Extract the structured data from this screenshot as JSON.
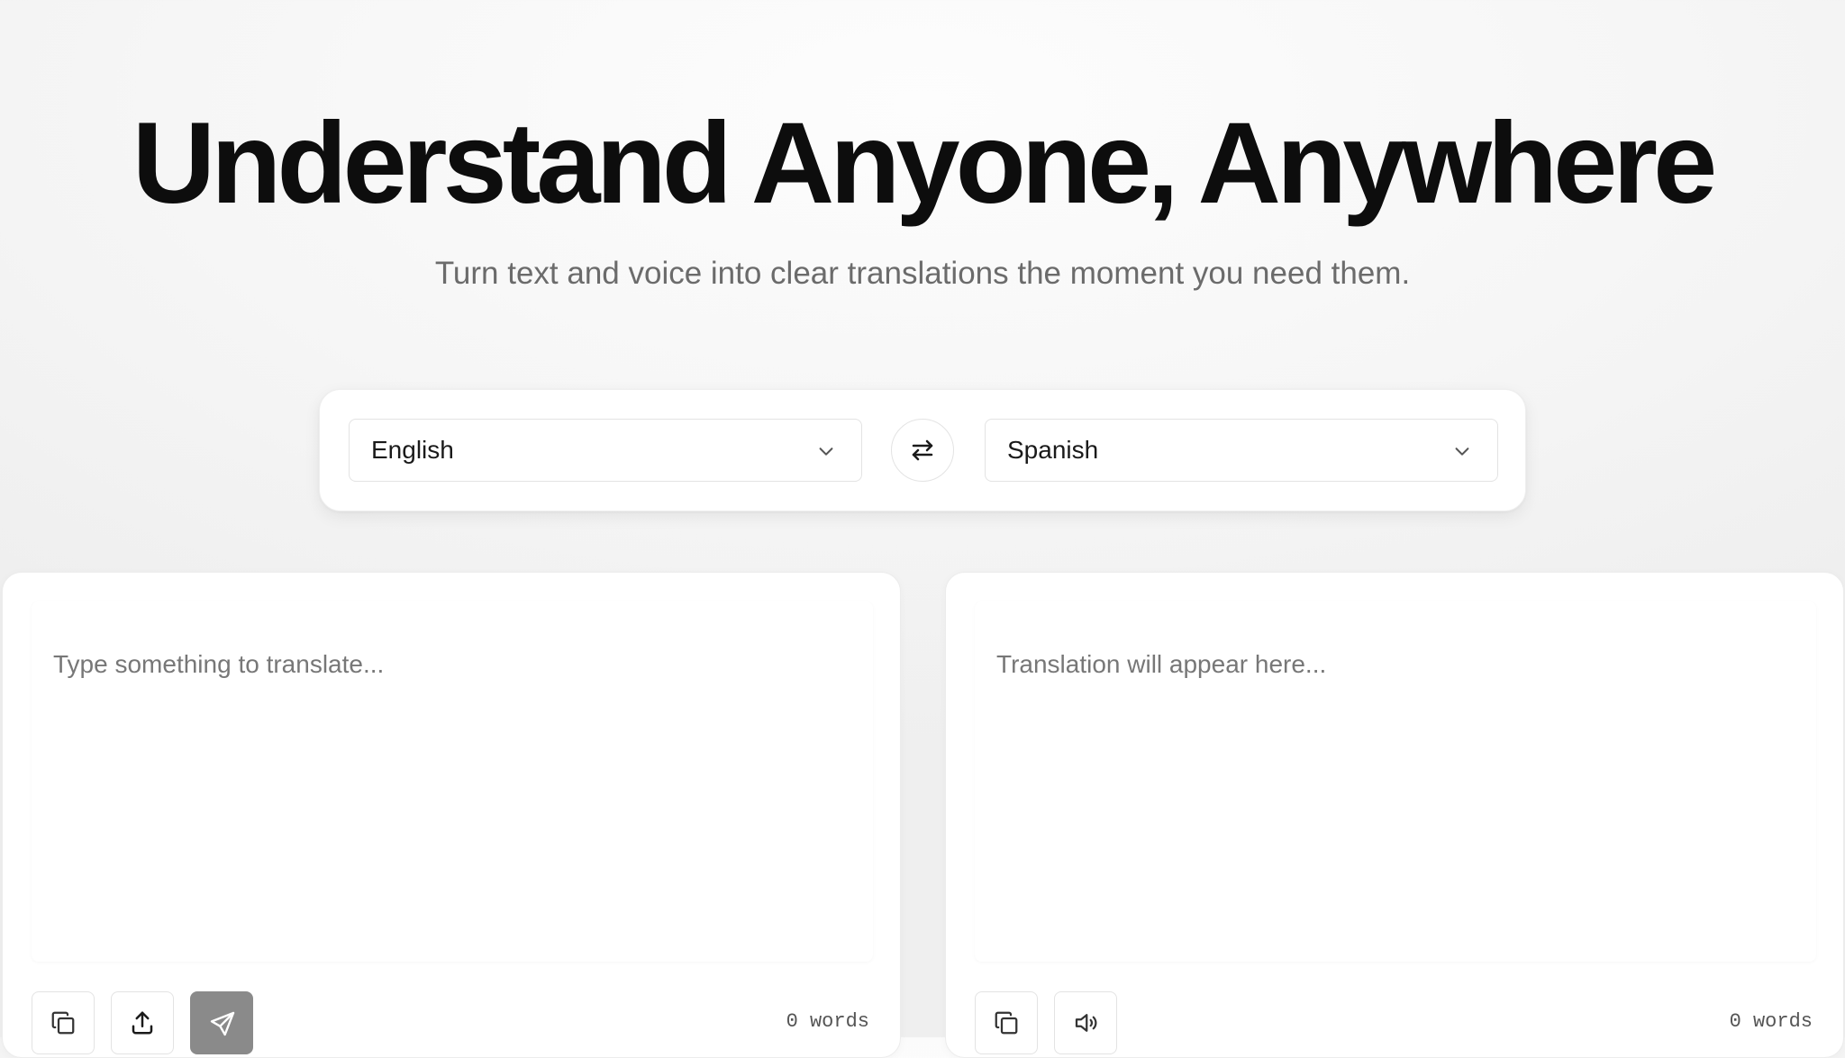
{
  "hero": {
    "title": "Understand Anyone, Anywhere",
    "subtitle": "Turn text and voice into clear translations the moment you need them."
  },
  "language_bar": {
    "source_language": "English",
    "target_language": "Spanish",
    "swap_icon": "swap-arrows-icon",
    "dropdown_icon": "chevron-down-icon"
  },
  "source_panel": {
    "placeholder": "Type something to translate...",
    "value": "",
    "word_count": "0 words",
    "buttons": [
      {
        "name": "copy",
        "icon": "copy-icon"
      },
      {
        "name": "upload",
        "icon": "upload-icon"
      },
      {
        "name": "send",
        "icon": "send-icon"
      }
    ]
  },
  "target_panel": {
    "placeholder": "Translation will appear here...",
    "word_count": "0 words",
    "buttons": [
      {
        "name": "copy",
        "icon": "copy-icon"
      },
      {
        "name": "speak",
        "icon": "speaker-icon"
      }
    ]
  },
  "colors": {
    "title": "#0d0d0d",
    "subtitle": "#6b6b6b",
    "send_button": "#8a8a8a",
    "border": "#e3e3e3"
  }
}
